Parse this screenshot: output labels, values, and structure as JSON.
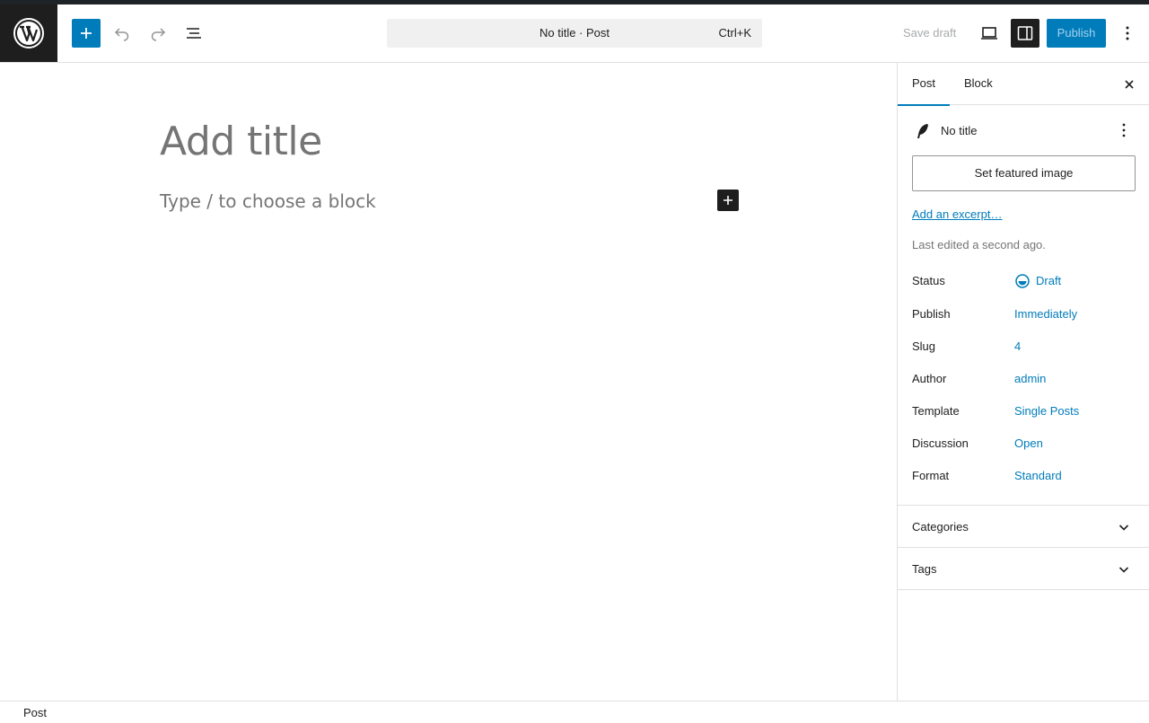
{
  "toolbar": {
    "document_title": "No title · Post",
    "shortcut": "Ctrl+K",
    "save_draft": "Save draft",
    "publish": "Publish"
  },
  "editor": {
    "title_placeholder": "Add title",
    "block_placeholder": "Type / to choose a block"
  },
  "sidebar": {
    "tabs": [
      {
        "label": "Post",
        "active": true
      },
      {
        "label": "Block",
        "active": false
      }
    ],
    "post_title": "No title",
    "featured_image_button": "Set featured image",
    "excerpt_link": "Add an excerpt…",
    "last_edited": "Last edited a second ago.",
    "rows": [
      {
        "label": "Status",
        "value": "Draft"
      },
      {
        "label": "Publish",
        "value": "Immediately"
      },
      {
        "label": "Slug",
        "value": "4"
      },
      {
        "label": "Author",
        "value": "admin"
      },
      {
        "label": "Template",
        "value": "Single Posts"
      },
      {
        "label": "Discussion",
        "value": "Open"
      },
      {
        "label": "Format",
        "value": "Standard"
      }
    ],
    "panels": [
      {
        "label": "Categories"
      },
      {
        "label": "Tags"
      }
    ]
  },
  "footer": {
    "breadcrumb": "Post"
  },
  "colors": {
    "accent": "#007cba",
    "dark": "#1e1e1e",
    "muted": "#757575"
  }
}
